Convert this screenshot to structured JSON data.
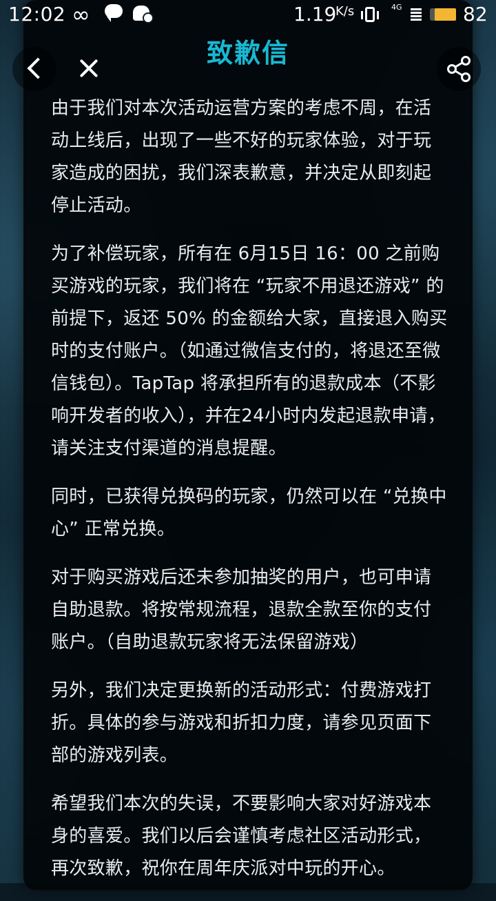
{
  "status_bar": {
    "time": "12:02",
    "net_speed": "1.19",
    "net_unit": "K/s",
    "network_type": "4G",
    "battery_level": "82",
    "battery_fraction": 0.82,
    "icons": [
      "infinity-icon",
      "chat-icon",
      "bot-icon",
      "vibrate-icon",
      "signal-icon",
      "battery-icon"
    ]
  },
  "header": {
    "title": "致歉信",
    "title_color": "#19b8d2",
    "back_icon": "chevron-left-icon",
    "close_icon": "close-icon",
    "share_icon": "share-icon"
  },
  "letter": {
    "paragraphs": [
      "由于我们对本次活动运营方案的考虑不周，在活动上线后，出现了一些不好的玩家体验，对于玩家造成的困扰，我们深表歉意，并决定从即刻起停止活动。",
      "为了补偿玩家，所有在 6月15日 16：00 之前购买游戏的玩家，我们将在 “玩家不用退还游戏” 的前提下，返还 50% 的金额给大家，直接退入购买时的支付账户。（如通过微信支付的，将退还至微信钱包）。TapTap 将承担所有的退款成本（不影响开发者的收入），并在24小时内发起退款申请，请关注支付渠道的消息提醒。",
      "同时，已获得兑换码的玩家，仍然可以在 “兑换中心” 正常兑换。",
      "对于购买游戏后还未参加抽奖的用户，也可申请自助退款。将按常规流程，退款全款至你的支付账户。（自助退款玩家将无法保留游戏）",
      "另外，我们决定更换新的活动形式：付费游戏打折。具体的参与游戏和折扣力度，请参见页面下部的游戏列表。",
      "希望我们本次的失误，不要影响大家对好游戏本身的喜爱。我们以后会谨慎考虑社区活动形式，再次致歉，祝你在周年庆派对中玩的开心。"
    ]
  }
}
